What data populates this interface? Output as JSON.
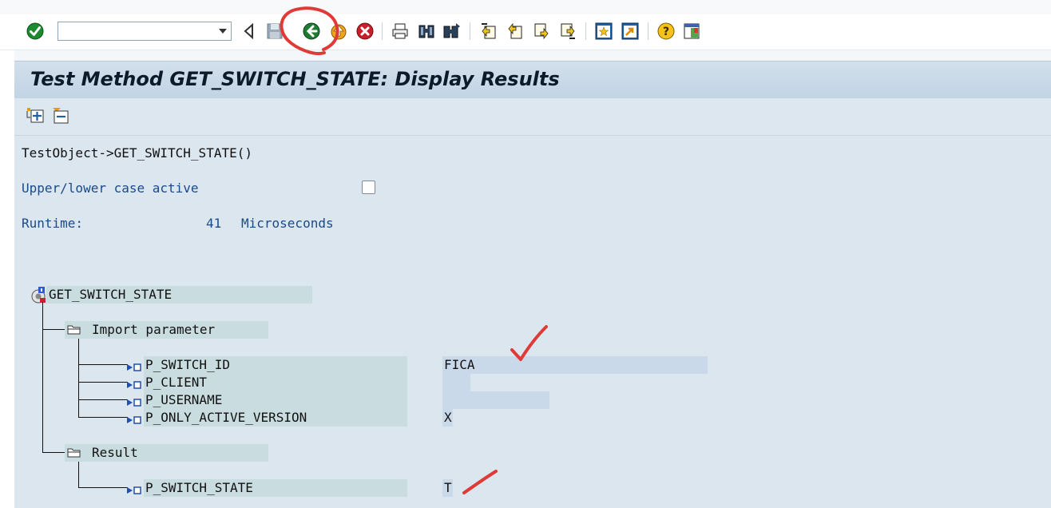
{
  "toolbar": {
    "command_field_value": "",
    "icons": [
      "enter-icon",
      "back-icon",
      "save-icon",
      "back-green-icon",
      "exit-icon",
      "cancel-icon",
      "print-icon",
      "find-icon",
      "find-next-icon",
      "first-page-icon",
      "previous-page-icon",
      "next-page-icon",
      "last-page-icon",
      "create-session-icon",
      "shortcut-icon",
      "help-icon",
      "customize-layout-icon"
    ]
  },
  "page": {
    "title": "Test Method GET_SWITCH_STATE: Display Results"
  },
  "subtoolbar": {
    "icons": [
      "expand-all-icon",
      "collapse-all-icon"
    ]
  },
  "content": {
    "call_line": "TestObject->GET_SWITCH_STATE()",
    "case_label": "Upper/lower case active",
    "case_checked": false,
    "runtime_label": "Runtime:",
    "runtime_value": "41",
    "runtime_unit": "Microseconds"
  },
  "tree": {
    "root": "GET_SWITCH_STATE",
    "import_folder": "Import parameter",
    "params": [
      {
        "name": "P_SWITCH_ID",
        "value": "FICA"
      },
      {
        "name": "P_CLIENT",
        "value": ""
      },
      {
        "name": "P_USERNAME",
        "value": ""
      },
      {
        "name": "P_ONLY_ACTIVE_VERSION",
        "value": "X"
      }
    ],
    "result_folder": "Result",
    "result": {
      "name": "P_SWITCH_STATE",
      "value": "T"
    }
  },
  "colors": {
    "annotation": "#e03a36",
    "title_bar": "#c8d8e8",
    "content_bg": "#dce6ef",
    "label_blue": "#1a4a87"
  }
}
